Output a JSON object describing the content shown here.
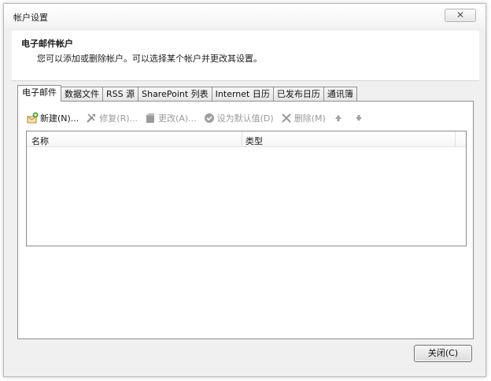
{
  "window": {
    "title": "帐户设置",
    "close_glyph": "✕"
  },
  "header": {
    "title": "电子邮件帐户",
    "description": "您可以添加或删除帐户。可以选择某个帐户并更改其设置。"
  },
  "tabs": [
    {
      "label": "电子邮件",
      "active": true
    },
    {
      "label": "数据文件"
    },
    {
      "label": "RSS 源"
    },
    {
      "label": "SharePoint 列表"
    },
    {
      "label": "Internet 日历"
    },
    {
      "label": "已发布日历"
    },
    {
      "label": "通讯簿"
    }
  ],
  "toolbar": {
    "new_label": "新建(N)...",
    "repair_label": "修复(R)...",
    "change_label": "更改(A)...",
    "set_default_label": "设为默认值(D)",
    "delete_label": "删除(M)"
  },
  "list": {
    "columns": [
      "名称",
      "类型"
    ]
  },
  "footer": {
    "close_label": "关闭(C)"
  },
  "icons": {
    "new": "new-account-icon",
    "repair": "repair-tools-icon",
    "change": "change-icon",
    "set_default": "checkmark-icon",
    "delete": "delete-x-icon",
    "move_up": "arrow-up-icon",
    "move_down": "arrow-down-icon"
  }
}
